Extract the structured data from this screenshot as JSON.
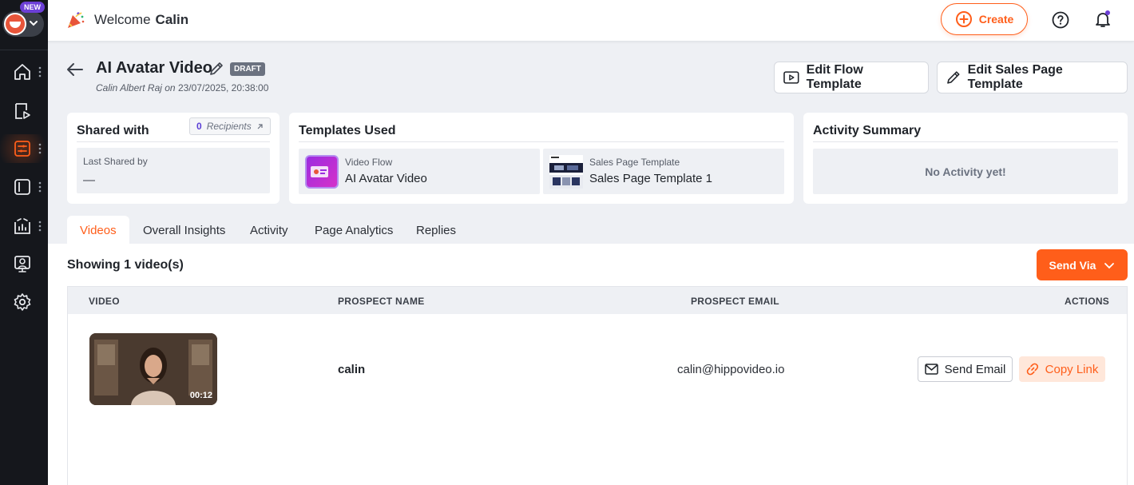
{
  "sidebar": {
    "badge": "NEW",
    "items": [
      {
        "icon": "home-icon"
      },
      {
        "icon": "video-play-icon"
      },
      {
        "icon": "flow-icon",
        "active": true
      },
      {
        "icon": "sidebar-panel-icon"
      },
      {
        "icon": "analytics-icon"
      },
      {
        "icon": "presenter-icon"
      },
      {
        "icon": "settings-icon"
      }
    ]
  },
  "topbar": {
    "welcome": "Welcome",
    "user_name": "Calin",
    "create_label": "Create"
  },
  "page": {
    "title": "AI Avatar Video",
    "status": "DRAFT",
    "author": "Calin Albert Raj on",
    "timestamp": "23/07/2025, 20:38:00",
    "edit_flow_label": "Edit Flow Template",
    "edit_sales_label": "Edit Sales Page Template"
  },
  "shared": {
    "title": "Shared with",
    "recipients_count": "0",
    "recipients_label": "Recipients",
    "last_shared_label": "Last Shared by",
    "last_shared_value": "—"
  },
  "templates": {
    "title": "Templates Used",
    "items": [
      {
        "kind": "Video Flow",
        "name": "AI Avatar Video"
      },
      {
        "kind": "Sales Page Template",
        "name": "Sales Page Template 1"
      }
    ]
  },
  "activity": {
    "title": "Activity Summary",
    "empty": "No Activity yet!"
  },
  "tabs": [
    {
      "label": "Videos",
      "active": true
    },
    {
      "label": "Overall Insights"
    },
    {
      "label": "Activity"
    },
    {
      "label": "Page Analytics"
    },
    {
      "label": "Replies"
    }
  ],
  "videos": {
    "showing": "Showing 1 video(s)",
    "send_via": "Send Via",
    "columns": [
      "VIDEO",
      "PROSPECT NAME",
      "PROSPECT EMAIL",
      "ACTIONS"
    ],
    "rows": [
      {
        "duration": "00:12",
        "prospect": "calin",
        "email": "calin@hippovideo.io",
        "send_email": "Send Email",
        "copy_link": "Copy Link"
      }
    ]
  },
  "colors": {
    "accent": "#ff5e1a",
    "sidebar_bg": "#15171c",
    "badge": "#6c3fd6"
  }
}
